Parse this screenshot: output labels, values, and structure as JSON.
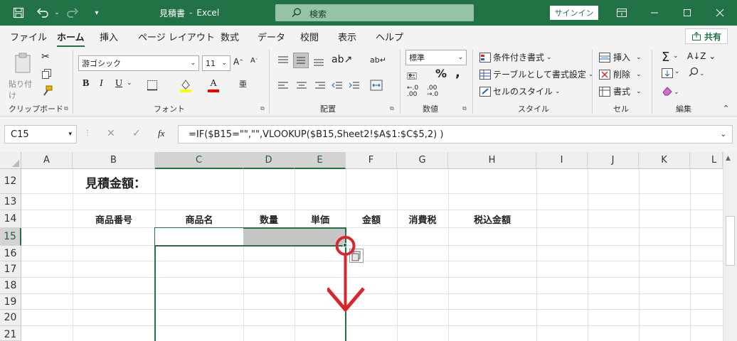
{
  "title": {
    "doc": "見積書",
    "sep": "-",
    "app": "Excel",
    "search_label": "検索",
    "signin": "サインイン"
  },
  "tabs": [
    "ファイル",
    "ホーム",
    "挿入",
    "ページ レイアウト",
    "数式",
    "データ",
    "校閲",
    "表示",
    "ヘルプ"
  ],
  "share": "共有",
  "ribbon": {
    "clipboard": {
      "label": "クリップボード",
      "paste": "貼り付け"
    },
    "font": {
      "label": "フォント",
      "name": "游ゴシック",
      "size": "11",
      "bold": "B",
      "italic": "I",
      "underline": "U",
      "fontcolor": "A",
      "phonetic": "亜"
    },
    "alignment": {
      "label": "配置"
    },
    "number": {
      "label": "数値",
      "format": "標準",
      "percent": "%",
      "comma": ","
    },
    "styles": {
      "label": "スタイル",
      "cond": "条件付き書式",
      "table": "テーブルとして書式設定",
      "cell": "セルのスタイル"
    },
    "cells": {
      "label": "セル",
      "insert": "挿入",
      "delete": "削除",
      "format": "書式"
    },
    "editing": {
      "label": "編集",
      "sum": "Σ"
    }
  },
  "namebox": "C15",
  "formula": "=IF($B15=\"\",\"\",VLOOKUP($B15,Sheet2!$A$1:$C$5,2) )",
  "columns": [
    "A",
    "B",
    "C",
    "D",
    "E",
    "F",
    "G",
    "H",
    "I",
    "J",
    "K",
    "L"
  ],
  "rows": [
    "12",
    "13",
    "14",
    "15",
    "16",
    "17",
    "18",
    "19",
    "20",
    "21"
  ],
  "cells": {
    "b12": "見積金額：",
    "b14": "商品番号",
    "c14": "商品名",
    "d14": "数量",
    "e14": "単価",
    "f14": "金額",
    "g14": "消費税",
    "h14": "税込金額"
  },
  "colors": {
    "accent": "#217346",
    "annotation": "#d9262c"
  }
}
